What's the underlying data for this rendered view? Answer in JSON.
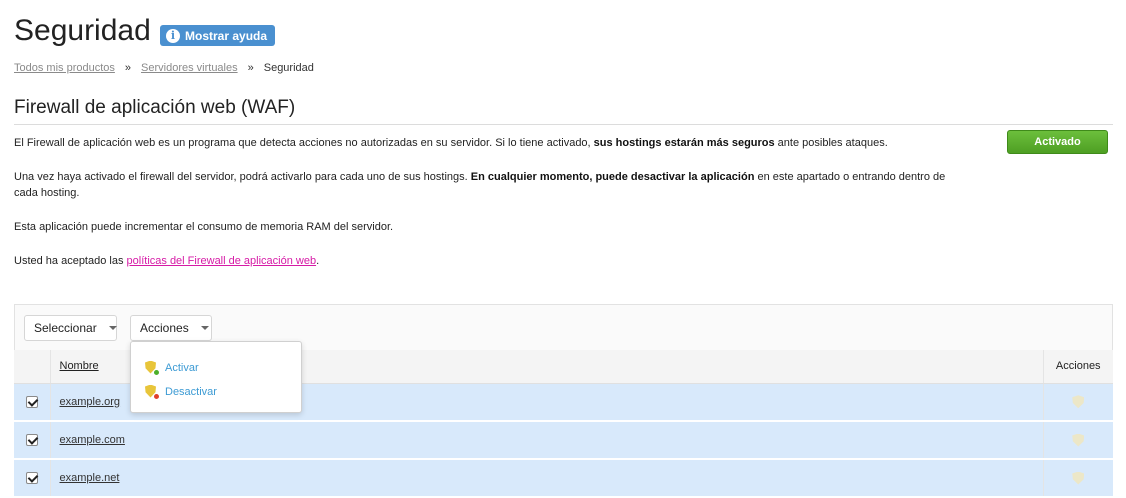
{
  "header": {
    "title": "Seguridad",
    "help_label": "Mostrar ayuda",
    "help_icon": "i"
  },
  "breadcrumb": {
    "items": [
      "Todos mis productos",
      "Servidores virtuales",
      "Seguridad"
    ],
    "separator": "»"
  },
  "waf": {
    "title": "Firewall de aplicación web (WAF)",
    "status_label": "Activado",
    "p1_a": "El Firewall de aplicación web es un programa que detecta acciones no autorizadas en su servidor. Si lo tiene activado, ",
    "p1_b": "sus hostings estarán más seguros",
    "p1_c": " ante posibles ataques.",
    "p2_a": "Una vez haya activado el firewall del servidor, podrá activarlo para cada uno de sus hostings. ",
    "p2_b": "En cualquier momento, puede desactivar la aplicación",
    "p2_c": " en este apartado o entrando dentro de cada hosting.",
    "p3": "Esta aplicación puede incrementar el consumo de memoria RAM del servidor.",
    "p4_a": "Usted ha aceptado las ",
    "p4_link": "políticas del Firewall de aplicación web",
    "p4_c": "."
  },
  "toolbar": {
    "select_label": "Seleccionar",
    "actions_label": "Acciones"
  },
  "dropdown": {
    "items": [
      {
        "label": "Activar",
        "icon": "shield-activate-icon"
      },
      {
        "label": "Desactivar",
        "icon": "shield-deactivate-icon"
      }
    ]
  },
  "table": {
    "columns": [
      "Nombre",
      "Acciones"
    ],
    "rows": [
      {
        "name": "example.org",
        "checked": true
      },
      {
        "name": "example.com",
        "checked": true
      },
      {
        "name": "example.net",
        "checked": true
      }
    ]
  },
  "colors": {
    "accent_blue": "#4a90d0",
    "status_green": "#5aaa2c",
    "link_pink": "#d61aa6",
    "row_selected": "#d8e9fb",
    "menu_link": "#3d9bd4"
  }
}
